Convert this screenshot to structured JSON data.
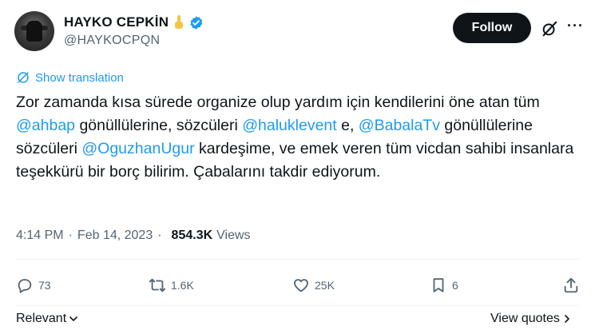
{
  "author": {
    "name": "HAYKO CEPKİN",
    "handle": "@HAYKOCPQN"
  },
  "header": {
    "follow_label": "Follow",
    "more_label": "···"
  },
  "translate_label": "Show translation",
  "tweet": {
    "p1": "Zor zamanda kısa sürede organize olup yardım için kendilerini öne atan tüm ",
    "m1": "@ahbap",
    "p2": " gönüllülerine, sözcüleri ",
    "m2": "@haluklevent",
    "p3": " e, ",
    "m3": "@BabalaTv",
    "p4": " gönüllülerine sözcüleri ",
    "m4": "@OguzhanUgur",
    "p5": " kardeşime, ve emek veren tüm vicdan sahibi insanlara teşekkürü bir borç bilirim. Çabalarını takdir ediyorum."
  },
  "meta": {
    "time": "4:14 PM",
    "separator": "·",
    "date": "Feb 14, 2023",
    "views_count": "854.3K",
    "views_label": "Views"
  },
  "actions": {
    "replies": "73",
    "reposts": "1.6K",
    "likes": "25K",
    "bookmarks": "6"
  },
  "footer": {
    "sort_label": "Relevant",
    "quotes_label": "View quotes"
  },
  "colors": {
    "accent": "#1d9bf0",
    "text": "#0f1419",
    "muted": "#536471"
  }
}
